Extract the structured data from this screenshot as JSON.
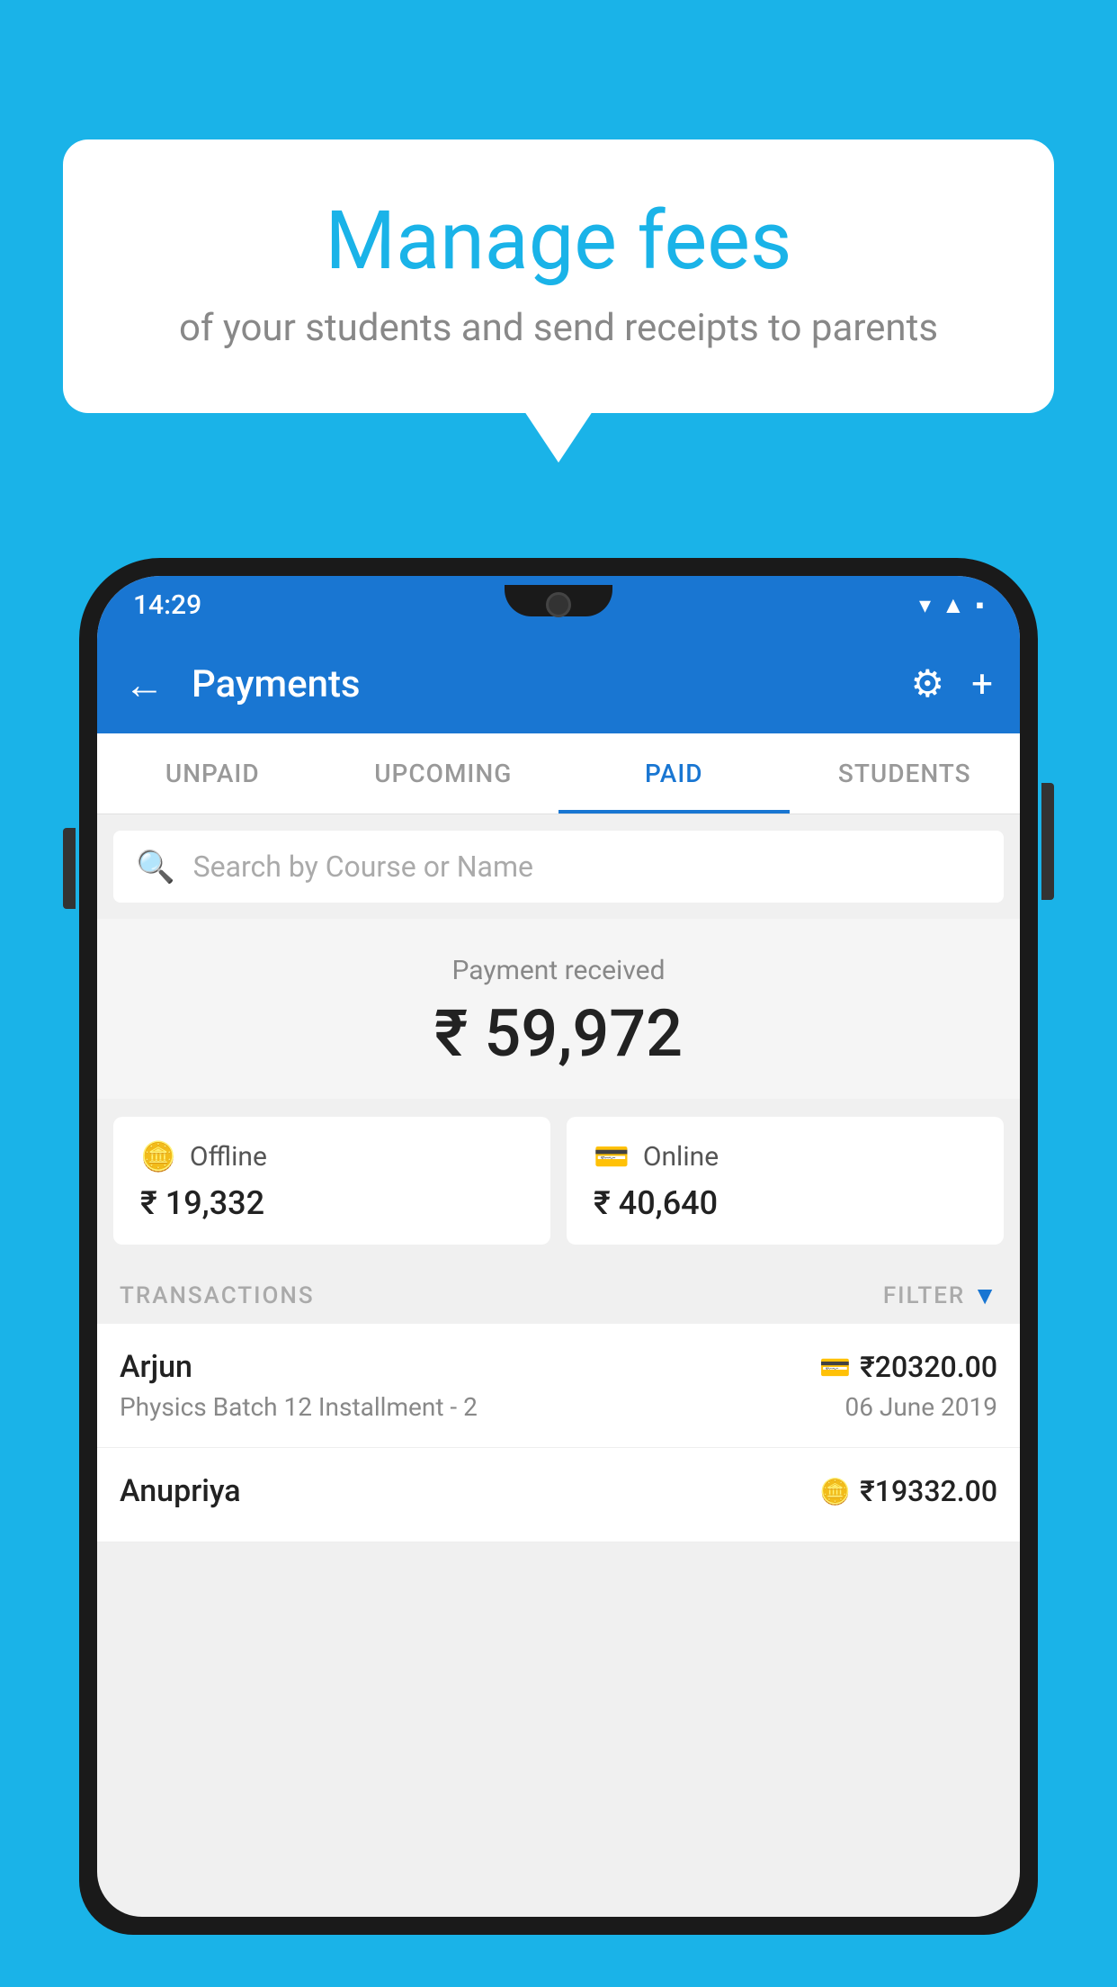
{
  "background_color": "#1ab3e8",
  "bubble": {
    "title": "Manage fees",
    "subtitle": "of your students and send receipts to parents"
  },
  "status_bar": {
    "time": "14:29",
    "wifi": "▾",
    "signal": "▲",
    "battery": "▪"
  },
  "app_bar": {
    "title": "Payments",
    "back_label": "←",
    "gear_label": "⚙",
    "plus_label": "+"
  },
  "tabs": [
    {
      "label": "UNPAID",
      "active": false
    },
    {
      "label": "UPCOMING",
      "active": false
    },
    {
      "label": "PAID",
      "active": true
    },
    {
      "label": "STUDENTS",
      "active": false
    }
  ],
  "search": {
    "placeholder": "Search by Course or Name"
  },
  "payment_received": {
    "label": "Payment received",
    "amount": "₹ 59,972"
  },
  "payment_cards": [
    {
      "type": "Offline",
      "icon": "🪙",
      "amount": "₹ 19,332"
    },
    {
      "type": "Online",
      "icon": "💳",
      "amount": "₹ 40,640"
    }
  ],
  "transactions": {
    "label": "TRANSACTIONS",
    "filter_label": "FILTER"
  },
  "transaction_list": [
    {
      "name": "Arjun",
      "course": "Physics Batch 12 Installment - 2",
      "date": "06 June 2019",
      "amount": "₹20320.00",
      "icon": "💳"
    },
    {
      "name": "Anupriya",
      "course": "",
      "date": "",
      "amount": "₹19332.00",
      "icon": "🪙"
    }
  ]
}
